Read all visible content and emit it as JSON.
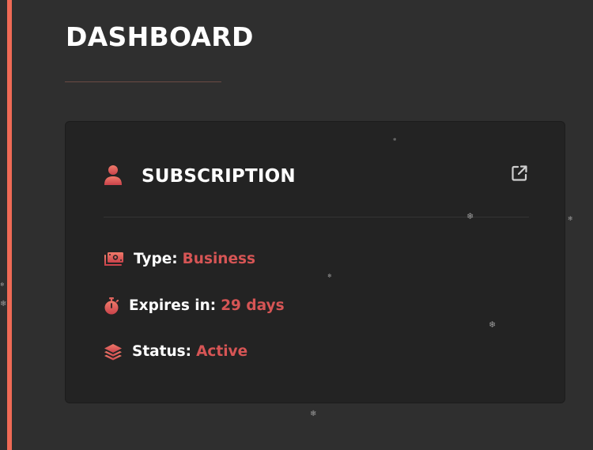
{
  "page": {
    "title": "DASHBOARD"
  },
  "card": {
    "title": "SUBSCRIPTION",
    "icon": "user-icon",
    "action_icon": "external-link-icon",
    "rows": [
      {
        "icon": "money-icon",
        "label": "Type:",
        "value": "Business"
      },
      {
        "icon": "stopwatch-icon",
        "label": "Expires in:",
        "value": "29 days"
      },
      {
        "icon": "layers-icon",
        "label": "Status:",
        "value": "Active"
      }
    ]
  },
  "colors": {
    "background": "#2f2f2f",
    "card_background": "#232323",
    "accent": "#ee6a55",
    "value_text": "#d65555",
    "text": "#ffffff"
  }
}
